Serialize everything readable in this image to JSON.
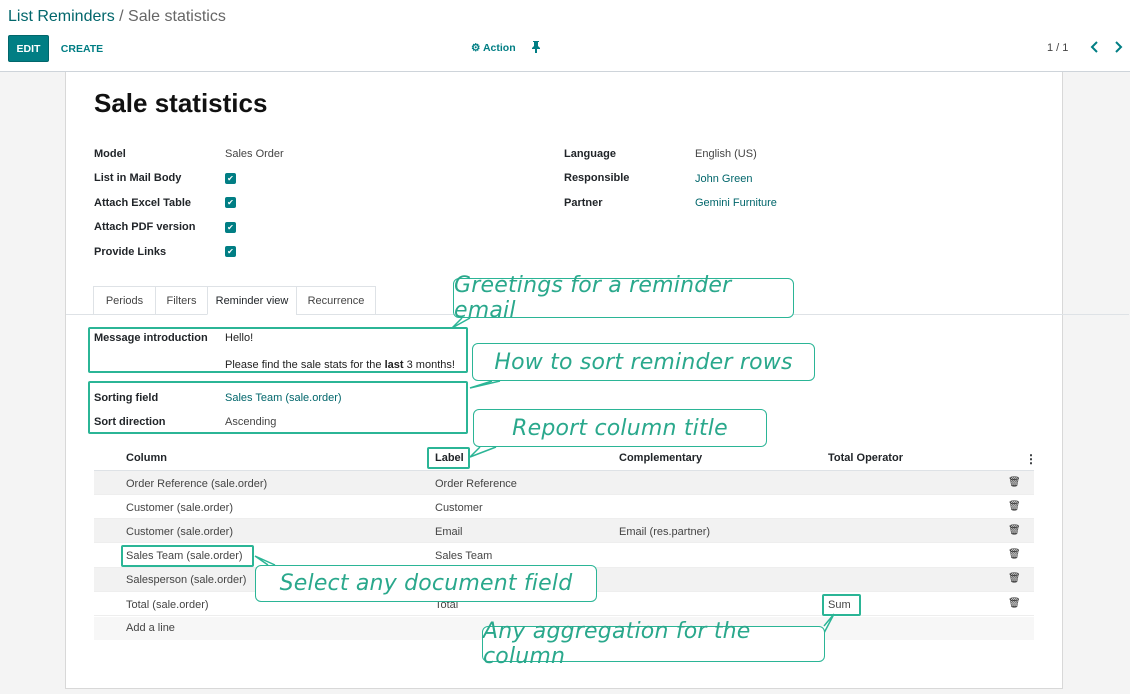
{
  "breadcrumb": {
    "parent": "List Reminders",
    "separator": " / ",
    "current": "Sale statistics"
  },
  "toolbar": {
    "edit_label": "EDIT",
    "create_label": "CREATE",
    "action_label": "Action",
    "action_icon": "gear-icon",
    "pin_icon": "pin-icon"
  },
  "pager": {
    "value": "1 / 1",
    "prev": "‹",
    "next": "›"
  },
  "record": {
    "title": "Sale statistics",
    "left_fields": [
      {
        "label": "Model",
        "value": "Sales Order"
      },
      {
        "label": "List in Mail Body",
        "checked": true
      },
      {
        "label": "Attach Excel Table",
        "checked": true
      },
      {
        "label": "Attach PDF version",
        "checked": true
      },
      {
        "label": "Provide Links",
        "checked": true
      }
    ],
    "right_fields": [
      {
        "label": "Language",
        "value": "English (US)"
      },
      {
        "label": "Responsible",
        "value": "John Green"
      },
      {
        "label": "Partner",
        "value": "Gemini Furniture"
      }
    ]
  },
  "tabs": [
    "Periods",
    "Filters",
    "Reminder view",
    "Recurrence"
  ],
  "reminder_view": {
    "message_label": "Message introduction",
    "message_line1": "Hello!",
    "message_line2_pre": "Please find the sale stats for the ",
    "message_line2_bold": "last",
    "message_line2_post": " 3 months!",
    "sorting_label": "Sorting field",
    "sorting_value": "Sales Team (sale.order)",
    "direction_label": "Sort direction",
    "direction_value": "Ascending"
  },
  "table": {
    "headers": [
      "Column",
      "Label",
      "Complementary",
      "Total Operator"
    ],
    "rows": [
      {
        "column": "Order Reference (sale.order)",
        "label": "Order Reference",
        "complementary": "",
        "operator": ""
      },
      {
        "column": "Customer (sale.order)",
        "label": "Customer",
        "complementary": "",
        "operator": ""
      },
      {
        "column": "Customer (sale.order)",
        "label": "Email",
        "complementary": "Email (res.partner)",
        "operator": ""
      },
      {
        "column": "Sales Team (sale.order)",
        "label": "Sales Team",
        "complementary": "",
        "operator": ""
      },
      {
        "column": "Salesperson (sale.order)",
        "label": "",
        "complementary": "",
        "operator": ""
      },
      {
        "column": "Total (sale.order)",
        "label": "Total",
        "complementary": "",
        "operator": "Sum"
      }
    ],
    "add_line": "Add a line"
  },
  "callouts": {
    "greetings": "Greetings for a reminder email",
    "sort": "How to sort reminder rows",
    "column_title": "Report column title",
    "document_field": "Select any document field",
    "aggregation": "Any aggregation for the column"
  },
  "colors": {
    "accent": "#017e84",
    "callout": "#2bb596"
  }
}
